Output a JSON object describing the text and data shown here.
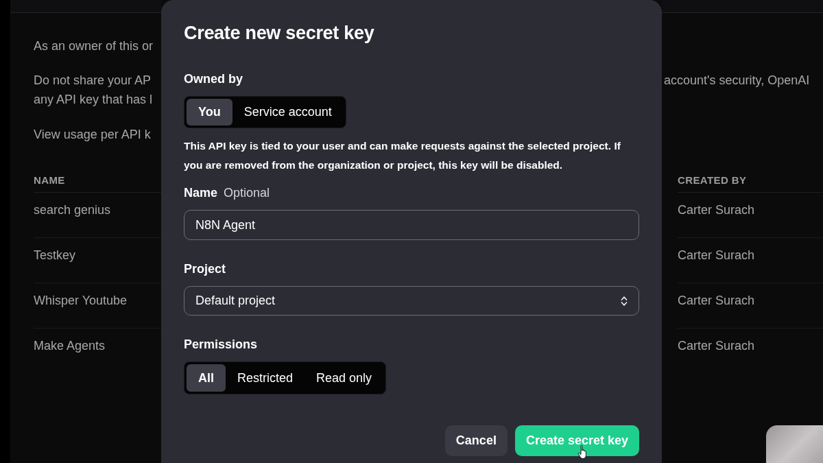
{
  "background": {
    "notes": [
      {
        "left": [
          "As an owner of this or"
        ]
      },
      {
        "left": [
          "Do not share your AP",
          "any API key that has l"
        ],
        "right": [
          "account's security, OpenAI"
        ]
      },
      {
        "left": [
          "View usage per API k"
        ]
      }
    ],
    "table": {
      "columns": [
        "NAME",
        "CREATED BY"
      ],
      "rows": [
        {
          "name": "search genius",
          "created_by": "Carter Surach"
        },
        {
          "name": "Testkey",
          "created_by": "Carter Surach"
        },
        {
          "name": "Whisper Youtube",
          "created_by": "Carter Surach"
        },
        {
          "name": "Make Agents",
          "created_by": "Carter Surach"
        }
      ]
    }
  },
  "dialog": {
    "title": "Create new secret key",
    "owned_by": {
      "label": "Owned by",
      "options": [
        {
          "label": "You",
          "selected": true
        },
        {
          "label": "Service account",
          "selected": false
        }
      ],
      "description": "This API key is tied to your user and can make requests against the selected project. If you are removed from the organization or project, this key will be disabled."
    },
    "name_field": {
      "label": "Name",
      "hint": "Optional",
      "value": "N8N Agent"
    },
    "project": {
      "label": "Project",
      "value": "Default project"
    },
    "permissions": {
      "label": "Permissions",
      "options": [
        {
          "label": "All",
          "selected": true
        },
        {
          "label": "Restricted",
          "selected": false
        },
        {
          "label": "Read only",
          "selected": false
        }
      ]
    },
    "buttons": [
      {
        "label": "Cancel",
        "kind": "secondary"
      },
      {
        "label": "Create secret key",
        "kind": "primary"
      }
    ]
  }
}
